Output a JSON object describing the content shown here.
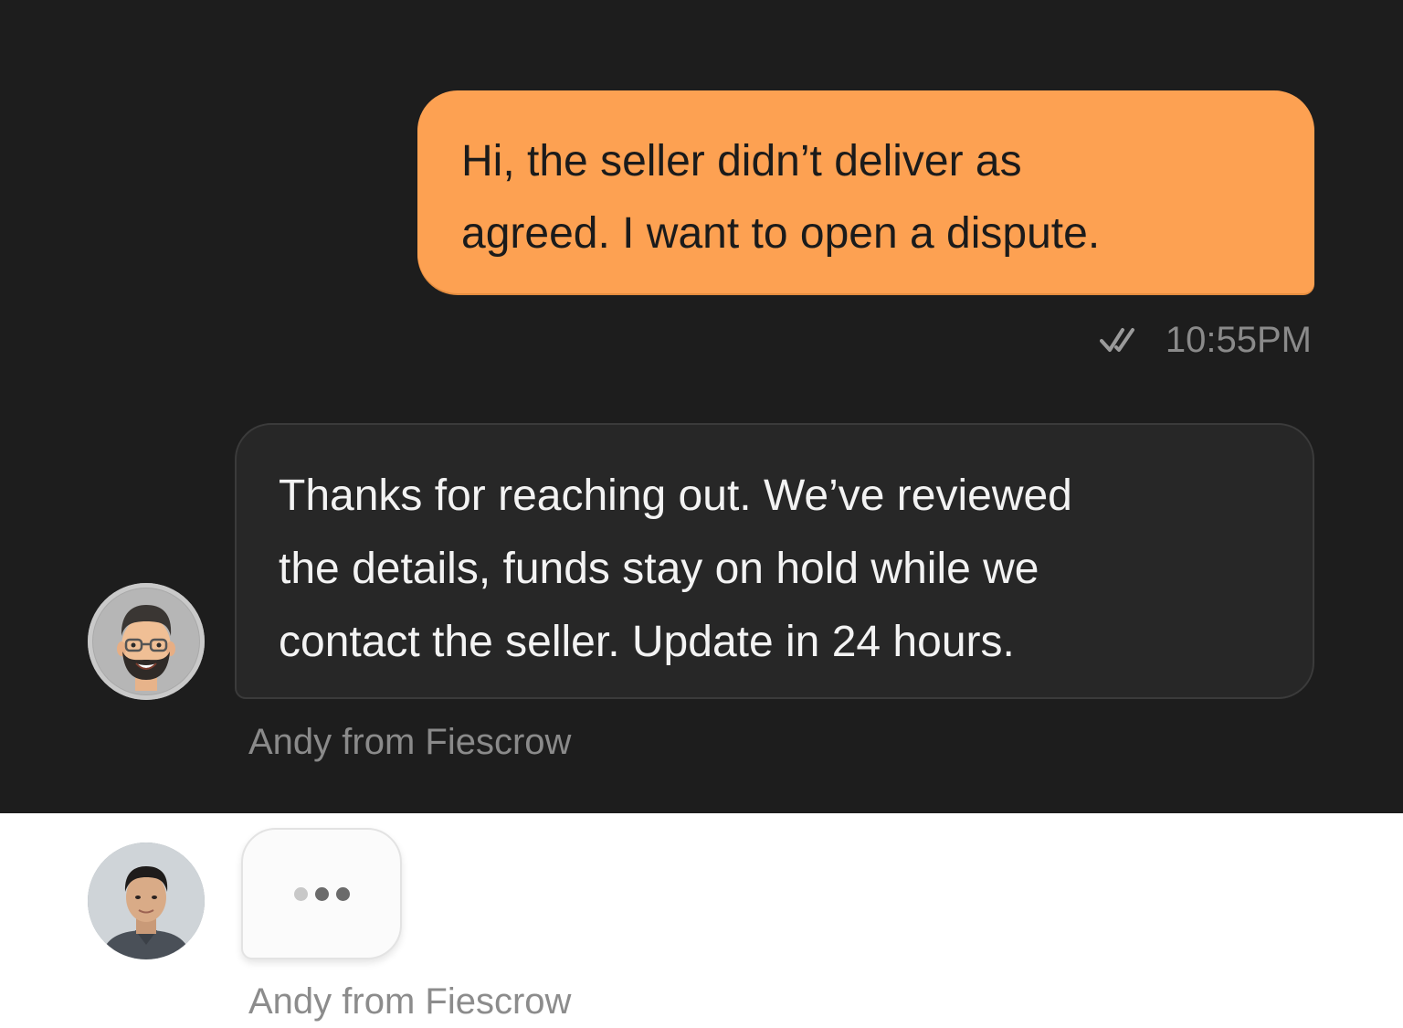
{
  "conversation": {
    "outgoing": {
      "lines": [
        "Hi, the seller didn’t deliver as",
        "agreed. I want to open a dispute."
      ],
      "time": "10:55PM",
      "status_icon": "double-check-icon"
    },
    "agent_reply": {
      "lines": [
        "Thanks for reaching out. We’ve reviewed",
        "the details, funds stay on hold while we",
        "contact the seller. Update in 24 hours."
      ],
      "sender": "Andy from Fiescrow",
      "avatar_icon": "memoji-avatar"
    },
    "typing": {
      "sender": "Andy from Fiescrow",
      "avatar_icon": "photo-avatar",
      "indicator_icon": "typing-dots-icon"
    }
  },
  "colors": {
    "dark_background": "#1d1d1d",
    "outgoing_bubble": "#fda152",
    "incoming_bubble": "#272727",
    "meta_text": "#8a8a8a"
  }
}
